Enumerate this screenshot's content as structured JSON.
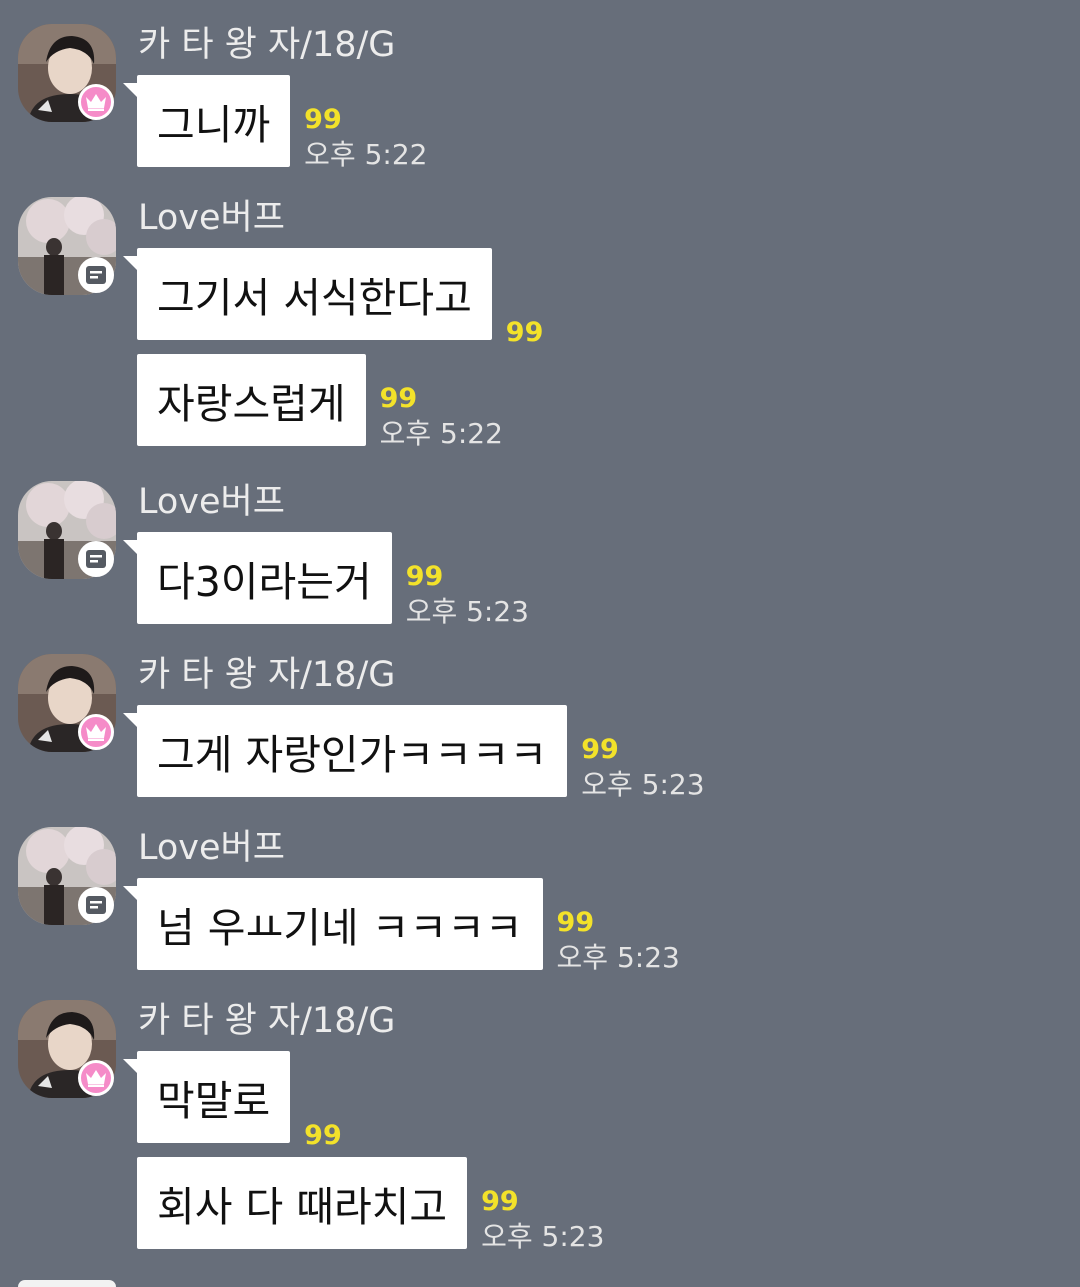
{
  "colors": {
    "background": "#676e7a",
    "bubble": "#ffffff",
    "unread": "#f3e22a",
    "crown_badge": "#f58bc8"
  },
  "groups": [
    {
      "sender": "카 타 왕 자/18/G",
      "badge": "crown-icon",
      "messages": [
        {
          "text": "그니까",
          "unread": "99",
          "time": "오후 5:22"
        }
      ]
    },
    {
      "sender": "Love버프",
      "badge": "card-icon",
      "messages": [
        {
          "text": "그기서 서식한다고",
          "unread": "99",
          "time": ""
        },
        {
          "text": "자랑스럽게",
          "unread": "99",
          "time": "오후 5:22"
        }
      ]
    },
    {
      "sender": "Love버프",
      "badge": "card-icon",
      "messages": [
        {
          "text": "다3이라는거",
          "unread": "99",
          "time": "오후 5:23"
        }
      ]
    },
    {
      "sender": "카 타 왕 자/18/G",
      "badge": "crown-icon",
      "messages": [
        {
          "text": "그게 자랑인가ㅋㅋㅋㅋ",
          "unread": "99",
          "time": "오후 5:23"
        }
      ]
    },
    {
      "sender": "Love버프",
      "badge": "card-icon",
      "messages": [
        {
          "text": "넘  우ㅛ기네 ㅋㅋㅋㅋ",
          "unread": "99",
          "time": "오후 5:23"
        }
      ]
    },
    {
      "sender": "카 타 왕 자/18/G",
      "badge": "crown-icon",
      "messages": [
        {
          "text": "막말로",
          "unread": "99",
          "time": ""
        },
        {
          "text": "회사 다 때라치고",
          "unread": "99",
          "time": "오후 5:23"
        }
      ]
    }
  ]
}
